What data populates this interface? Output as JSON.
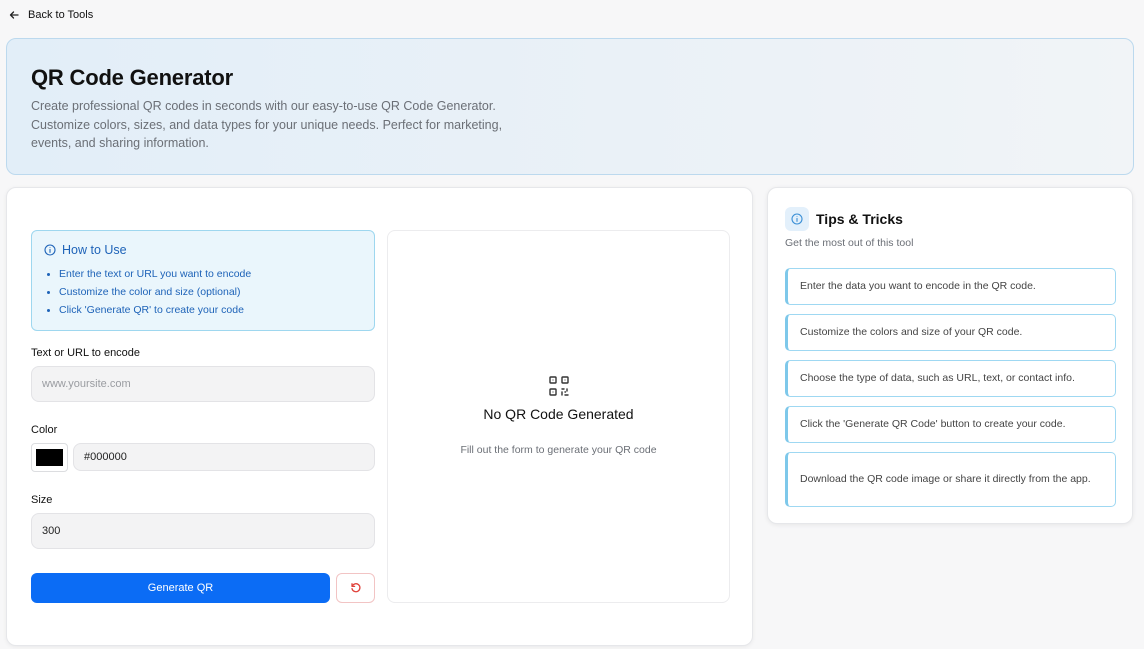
{
  "nav": {
    "back_label": "Back to Tools"
  },
  "hero": {
    "title": "QR Code Generator",
    "description": "Create professional QR codes in seconds with our easy-to-use QR Code Generator. Customize colors, sizes, and data types for your unique needs. Perfect for marketing, events, and sharing information."
  },
  "howto": {
    "title": "How to Use",
    "steps": [
      "Enter the text or URL you want to encode",
      "Customize the color and size (optional)",
      "Click 'Generate QR' to create your code"
    ]
  },
  "form": {
    "text_label": "Text or URL to encode",
    "text_placeholder": "www.yoursite.com",
    "color_label": "Color",
    "color_value": "#000000",
    "size_label": "Size",
    "size_value": "300",
    "generate_label": "Generate QR"
  },
  "preview": {
    "icon": "qr-code-icon",
    "title": "No QR Code Generated",
    "subtitle": "Fill out the form to generate your QR code"
  },
  "tips": {
    "title": "Tips & Tricks",
    "subtitle": "Get the most out of this tool",
    "items": [
      "Enter the data you want to encode in the QR code.",
      "Customize the colors and size of your QR code.",
      "Choose the type of data, such as URL, text, or contact info.",
      "Click the 'Generate QR Code' button to create your code.",
      "Download the QR code image or share it directly from the app."
    ]
  },
  "colors": {
    "accent": "#0b6cf5",
    "info_text": "#1e63b8",
    "reset_icon": "#e0413a"
  }
}
